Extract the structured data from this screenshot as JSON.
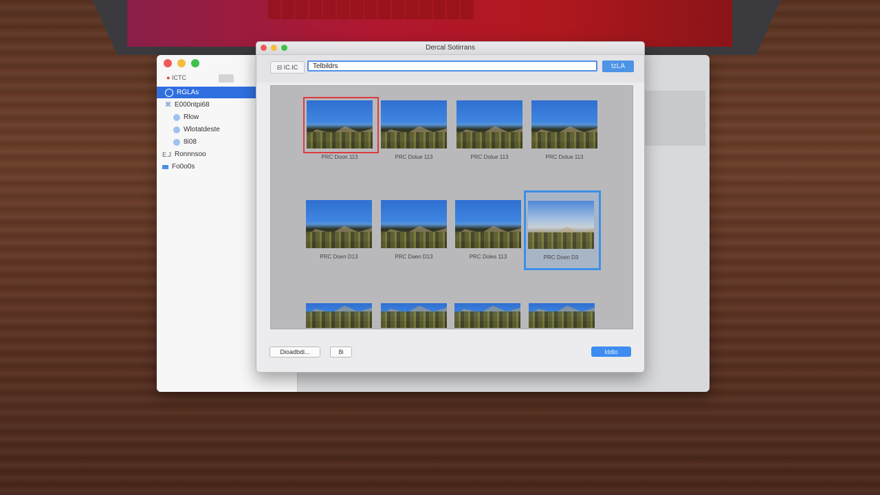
{
  "finder": {
    "sidebar": {
      "items": [
        {
          "label": "RGLAs",
          "icon": "globe-icon",
          "selected": true
        },
        {
          "label": "E000ntpi68",
          "icon": "folder-icon",
          "selected": false
        },
        {
          "label": "Rlow",
          "icon": "cloud-icon",
          "selected": false
        },
        {
          "label": "Wlotatdeste",
          "icon": "cloud-icon",
          "selected": false
        },
        {
          "label": "8i08",
          "icon": "cloud-icon",
          "selected": false
        },
        {
          "label": "Ronnnsoo",
          "icon": "folder-icon",
          "selected": false
        },
        {
          "label": "Fo0o0s",
          "icon": "drive-icon",
          "selected": false
        }
      ],
      "toolbar_label": "ICTC"
    }
  },
  "dialog": {
    "title": "Dercal Sotirrans",
    "toolbar": {
      "back_label": "⊟ IC.IC",
      "search_value": "Telbildrs",
      "go_label": "tzLA"
    },
    "thumbnails": [
      {
        "label": "PRC Doon 113",
        "selected": "red"
      },
      {
        "label": "PRC Dolue 113",
        "selected": "none"
      },
      {
        "label": "PRC Dolue 113",
        "selected": "none"
      },
      {
        "label": "PRC Dolue 113",
        "selected": "none"
      },
      {
        "label": "PRC Doen D13",
        "selected": "none"
      },
      {
        "label": "PRC Daen D13",
        "selected": "none"
      },
      {
        "label": "PRC Doles 113",
        "selected": "none"
      },
      {
        "label": "PRC Doen D3",
        "selected": "blue"
      },
      {
        "label": "",
        "selected": "none"
      },
      {
        "label": "",
        "selected": "none"
      },
      {
        "label": "",
        "selected": "none"
      },
      {
        "label": "",
        "selected": "none"
      }
    ],
    "footer": {
      "left_button": "Dioadbdi...",
      "small_button": "8i",
      "primary_button": "Iddlo"
    }
  },
  "colors": {
    "accent": "#3d8cf0",
    "selection_red": "#e0393d",
    "selection_blue": "#3c8fe6"
  }
}
